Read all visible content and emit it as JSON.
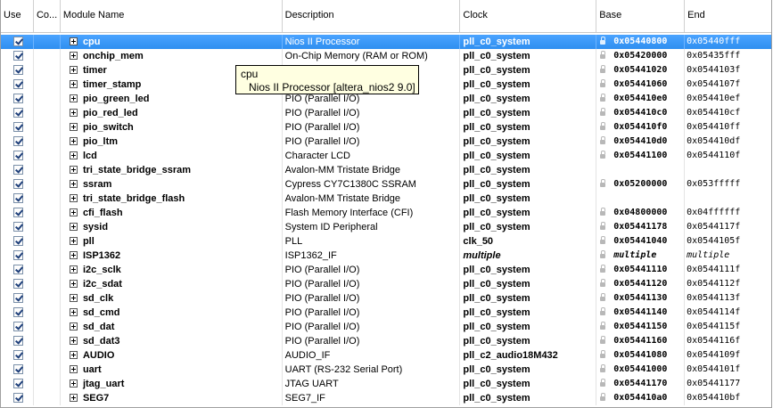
{
  "columns": {
    "use": "Use",
    "connections": "Co...",
    "module_name": "Module Name",
    "description": "Description",
    "clock": "Clock",
    "base": "Base",
    "end": "End"
  },
  "rows": [
    {
      "name": "cpu",
      "desc": "Nios II Processor",
      "clock": "pll_c0_system",
      "base": "0x05440800",
      "end": "0x05440fff",
      "selected": true,
      "lock": true
    },
    {
      "name": "onchip_mem",
      "desc": "On-Chip Memory (RAM or ROM)",
      "clock": "pll_c0_system",
      "base": "0x05420000",
      "end": "0x05435fff",
      "lock": true
    },
    {
      "name": "timer",
      "desc": "",
      "clock": "pll_c0_system",
      "base": "0x05441020",
      "end": "0x0544103f",
      "lock": true
    },
    {
      "name": "timer_stamp",
      "desc": "",
      "clock": "pll_c0_system",
      "base": "0x05441060",
      "end": "0x0544107f",
      "lock": true
    },
    {
      "name": "pio_green_led",
      "desc": "PIO (Parallel I/O)",
      "clock": "pll_c0_system",
      "base": "0x054410e0",
      "end": "0x054410ef",
      "lock": true
    },
    {
      "name": "pio_red_led",
      "desc": "PIO (Parallel I/O)",
      "clock": "pll_c0_system",
      "base": "0x054410c0",
      "end": "0x054410cf",
      "lock": true
    },
    {
      "name": "pio_switch",
      "desc": "PIO (Parallel I/O)",
      "clock": "pll_c0_system",
      "base": "0x054410f0",
      "end": "0x054410ff",
      "lock": true
    },
    {
      "name": "pio_ltm",
      "desc": "PIO (Parallel I/O)",
      "clock": "pll_c0_system",
      "base": "0x054410d0",
      "end": "0x054410df",
      "lock": true
    },
    {
      "name": "lcd",
      "desc": "Character LCD",
      "clock": "pll_c0_system",
      "base": "0x05441100",
      "end": "0x0544110f",
      "lock": true
    },
    {
      "name": "tri_state_bridge_ssram",
      "desc": "Avalon-MM Tristate Bridge",
      "clock": "pll_c0_system",
      "base": "",
      "end": "",
      "lock": false
    },
    {
      "name": "ssram",
      "desc": "Cypress CY7C1380C SSRAM",
      "clock": "pll_c0_system",
      "base": "0x05200000",
      "end": "0x053fffff",
      "lock": true
    },
    {
      "name": "tri_state_bridge_flash",
      "desc": "Avalon-MM Tristate Bridge",
      "clock": "pll_c0_system",
      "base": "",
      "end": "",
      "lock": false
    },
    {
      "name": "cfi_flash",
      "desc": "Flash Memory Interface (CFI)",
      "clock": "pll_c0_system",
      "base": "0x04800000",
      "end": "0x04ffffff",
      "lock": true
    },
    {
      "name": "sysid",
      "desc": "System ID Peripheral",
      "clock": "pll_c0_system",
      "base": "0x05441178",
      "end": "0x0544117f",
      "lock": true
    },
    {
      "name": "pll",
      "desc": "PLL",
      "clock": "clk_50",
      "base": "0x05441040",
      "end": "0x0544105f",
      "lock": true
    },
    {
      "name": "ISP1362",
      "desc": "ISP1362_IF",
      "clock": "multiple",
      "base": "multiple",
      "end": "multiple",
      "lock": true,
      "italic": true
    },
    {
      "name": "i2c_sclk",
      "desc": "PIO (Parallel I/O)",
      "clock": "pll_c0_system",
      "base": "0x05441110",
      "end": "0x0544111f",
      "lock": true
    },
    {
      "name": "i2c_sdat",
      "desc": "PIO (Parallel I/O)",
      "clock": "pll_c0_system",
      "base": "0x05441120",
      "end": "0x0544112f",
      "lock": true
    },
    {
      "name": "sd_clk",
      "desc": "PIO (Parallel I/O)",
      "clock": "pll_c0_system",
      "base": "0x05441130",
      "end": "0x0544113f",
      "lock": true
    },
    {
      "name": "sd_cmd",
      "desc": "PIO (Parallel I/O)",
      "clock": "pll_c0_system",
      "base": "0x05441140",
      "end": "0x0544114f",
      "lock": true
    },
    {
      "name": "sd_dat",
      "desc": "PIO (Parallel I/O)",
      "clock": "pll_c0_system",
      "base": "0x05441150",
      "end": "0x0544115f",
      "lock": true
    },
    {
      "name": "sd_dat3",
      "desc": "PIO (Parallel I/O)",
      "clock": "pll_c0_system",
      "base": "0x05441160",
      "end": "0x0544116f",
      "lock": true
    },
    {
      "name": "AUDIO",
      "desc": "AUDIO_IF",
      "clock": "pll_c2_audio18M432",
      "base": "0x05441080",
      "end": "0x0544109f",
      "lock": true
    },
    {
      "name": "uart",
      "desc": "UART (RS-232 Serial Port)",
      "clock": "pll_c0_system",
      "base": "0x05441000",
      "end": "0x0544101f",
      "lock": true
    },
    {
      "name": "jtag_uart",
      "desc": "JTAG UART",
      "clock": "pll_c0_system",
      "base": "0x05441170",
      "end": "0x05441177",
      "lock": true
    },
    {
      "name": "SEG7",
      "desc": "SEG7_IF",
      "clock": "pll_c0_system",
      "base": "0x054410a0",
      "end": "0x054410bf",
      "lock": true
    }
  ],
  "tooltip": {
    "title": "cpu",
    "description": "Nios II Processor [altera_nios2 9.0]"
  },
  "icons": {
    "checkbox": "checkbox-checked-icon",
    "expand": "plus-expand-icon",
    "lock": "lock-icon"
  }
}
